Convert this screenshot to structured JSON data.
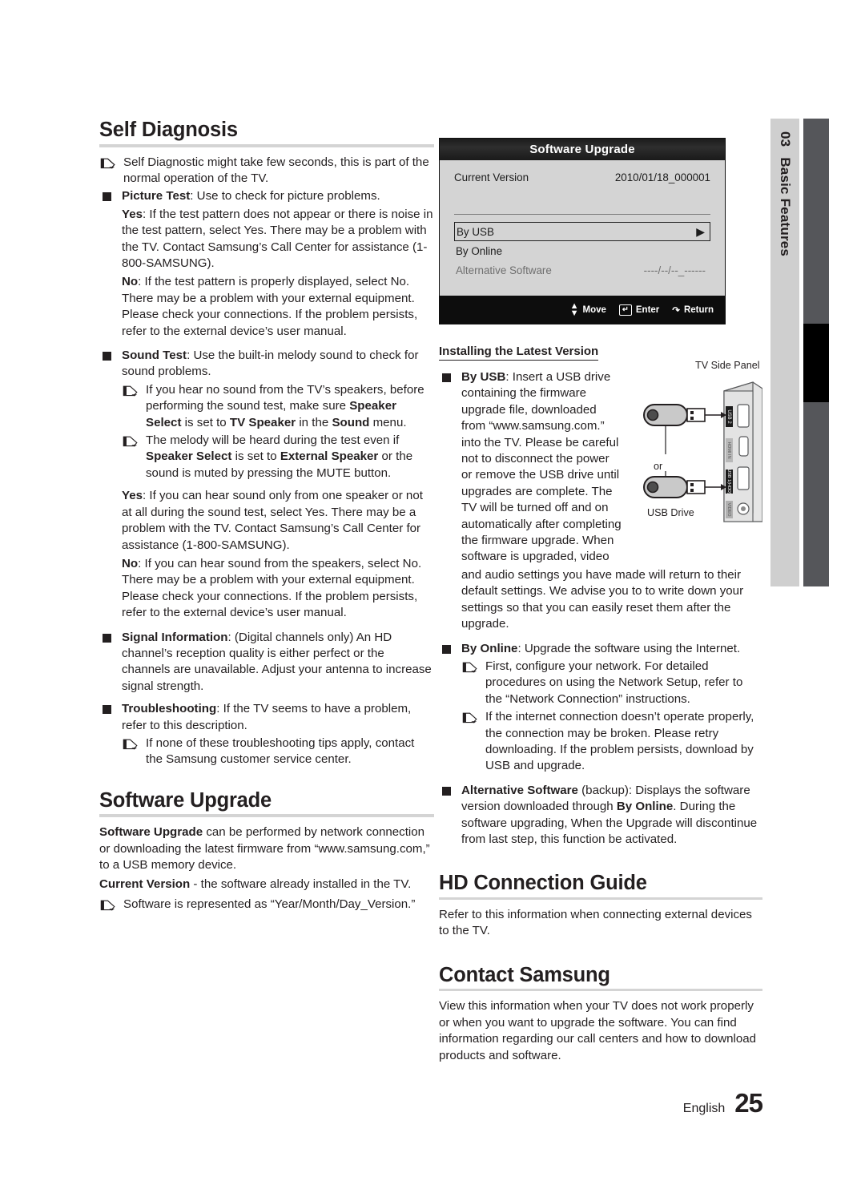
{
  "chapter": {
    "number": "03",
    "title": "Basic Features"
  },
  "footer": {
    "language": "English",
    "page": "25"
  },
  "left_column": {
    "self_diagnosis": {
      "heading": "Self Diagnosis",
      "note_intro": "Self Diagnostic might take few seconds, this is part of the normal operation of the TV.",
      "picture_test": {
        "term": "Picture Test",
        "desc": ": Use to check for picture problems.",
        "yes_term": "Yes",
        "yes_desc": ": If the test pattern does not appear or there is noise in the test pattern, select Yes. There may be a problem with the TV. Contact Samsung’s Call Center for assistance (1-800-SAMSUNG).",
        "no_term": "No",
        "no_desc": ": If the test pattern is properly displayed, select No. There may be a problem with your external equipment. Please check your connections. If the problem persists, refer to the external device’s user manual."
      },
      "sound_test": {
        "term": "Sound Test",
        "desc": ": Use the built-in melody sound to check for sound problems.",
        "note1_a": "If you hear no sound from the TV’s speakers, before performing the sound test, make sure ",
        "note1_b": "Speaker Select",
        "note1_c": " is set to ",
        "note1_d": "TV Speaker",
        "note1_e": " in the ",
        "note1_f": "Sound",
        "note1_g": " menu.",
        "note2_a": "The melody will be heard during the test even if ",
        "note2_b": "Speaker Select",
        "note2_c": " is set to ",
        "note2_d": "External Speaker",
        "note2_e": " or the sound is muted by pressing the MUTE button.",
        "yes_term": "Yes",
        "yes_desc": ": If you can hear sound only from one speaker or not at all during the sound test, select Yes. There may be a problem with the TV. Contact Samsung’s Call Center for assistance (1-800-SAMSUNG).",
        "no_term": "No",
        "no_desc": ": If you can hear sound from the speakers, select No. There may be a problem with your external equipment. Please check your connections. If the problem persists, refer to the external device’s user manual."
      },
      "signal_information": {
        "term": "Signal Information",
        "desc": ": (Digital channels only) An HD channel’s reception quality is either perfect or the channels are unavailable. Adjust your antenna to increase signal strength."
      },
      "troubleshooting": {
        "term": "Troubleshooting",
        "desc": ": If the TV seems to have a problem, refer to this description.",
        "note": "If none of these troubleshooting tips apply, contact the Samsung customer service center."
      }
    },
    "software_upgrade": {
      "heading": "Software Upgrade",
      "p1_term": "Software Upgrade",
      "p1_desc": " can be performed by network connection or downloading the latest firmware from “www.samsung.com,” to a USB memory device.",
      "p2_term": "Current Version",
      "p2_desc": " - the software already installed in the TV.",
      "note": "Software is represented as “Year/Month/Day_Version.”"
    }
  },
  "osd": {
    "title": "Software Upgrade",
    "current_version_label": "Current Version",
    "current_version_value": "2010/01/18_000001",
    "items": [
      {
        "label": "By USB",
        "value": "",
        "selected": true,
        "arrow": "▶"
      },
      {
        "label": "By Online",
        "value": "",
        "selected": false,
        "arrow": ""
      },
      {
        "label": "Alternative Software",
        "value": "----/--/--_------",
        "selected": false,
        "arrow": ""
      }
    ],
    "footer": {
      "move": "Move",
      "enter": "Enter",
      "return": "Return"
    }
  },
  "diagram": {
    "tv_side_panel": "TV Side Panel",
    "usb_drive": "USB Drive",
    "or": "or",
    "ports": [
      "USB 2",
      "HDMI IN",
      "USB 1(HDD)",
      "VIDEO"
    ]
  },
  "right_column": {
    "installing": {
      "heading": "Installing the Latest Version",
      "by_usb": {
        "term": "By USB",
        "desc_wrapped": ": Insert a USB drive containing the firmware upgrade file, downloaded from “www.samsung.com.” into the TV. Please be careful not to disconnect the power or remove the USB drive until upgrades are complete. The TV will be turned off and on automatically after completing the firmware upgrade. When software is upgraded, video",
        "desc_full": "and audio settings you have made will return to their default settings. We advise you to to write down your settings so that you can easily reset them after the upgrade."
      },
      "by_online": {
        "term": "By Online",
        "desc": ": Upgrade the software using the Internet.",
        "note1": "First, configure your network. For detailed procedures on using the Network Setup, refer to the “Network Connection” instructions.",
        "note2": "If the internet connection doesn’t operate properly, the connection may be broken. Please retry downloading. If the problem persists, download by USB and upgrade."
      },
      "alternative": {
        "term": "Alternative Software",
        "desc_a": " (backup): Displays the software version downloaded through ",
        "desc_b": "By Online",
        "desc_c": ". During the software upgrading, When the Upgrade will discontinue from last step, this function be activated."
      }
    },
    "hd_connection_guide": {
      "heading": "HD Connection Guide",
      "body": "Refer to this information when connecting external devices to the TV."
    },
    "contact_samsung": {
      "heading": "Contact Samsung",
      "body": "View this information when your TV does not work properly or when you want to upgrade the software. You can find information regarding our call centers and how to download products and software."
    }
  }
}
